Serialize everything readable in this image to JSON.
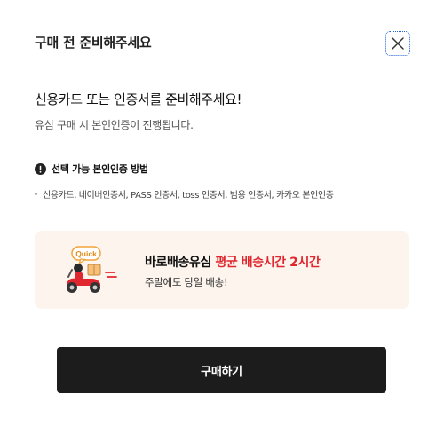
{
  "header": {
    "title": "구매 전 준비해주세요",
    "close_icon": "close-icon"
  },
  "intro": {
    "title": "신용카드 또는 인증서를 준비해주세요!",
    "subtitle": "유심 구매 시 본인인증이 진행됩니다."
  },
  "methods": {
    "title": "선택 가능 본인인증 방법",
    "icon": "alert-circle-icon",
    "list": "신용카드, 네이버인증서, PASS 인증서, toss 인증서, 범용 인증서, 카카오 본인인증"
  },
  "promo": {
    "badge": "Quick",
    "title_prefix": "바로배송유심 ",
    "title_highlight": "평균 배송시간 2시간",
    "subtitle": "주말에도 당일 배송!",
    "icon": "delivery-scooter-icon",
    "highlight_color": "#e0272f",
    "background_color": "#fdf4ed"
  },
  "footer": {
    "buy_label": "구매하기"
  },
  "colors": {
    "button_bg": "#1c1c1c",
    "focus_outline": "#1f5fd6"
  }
}
